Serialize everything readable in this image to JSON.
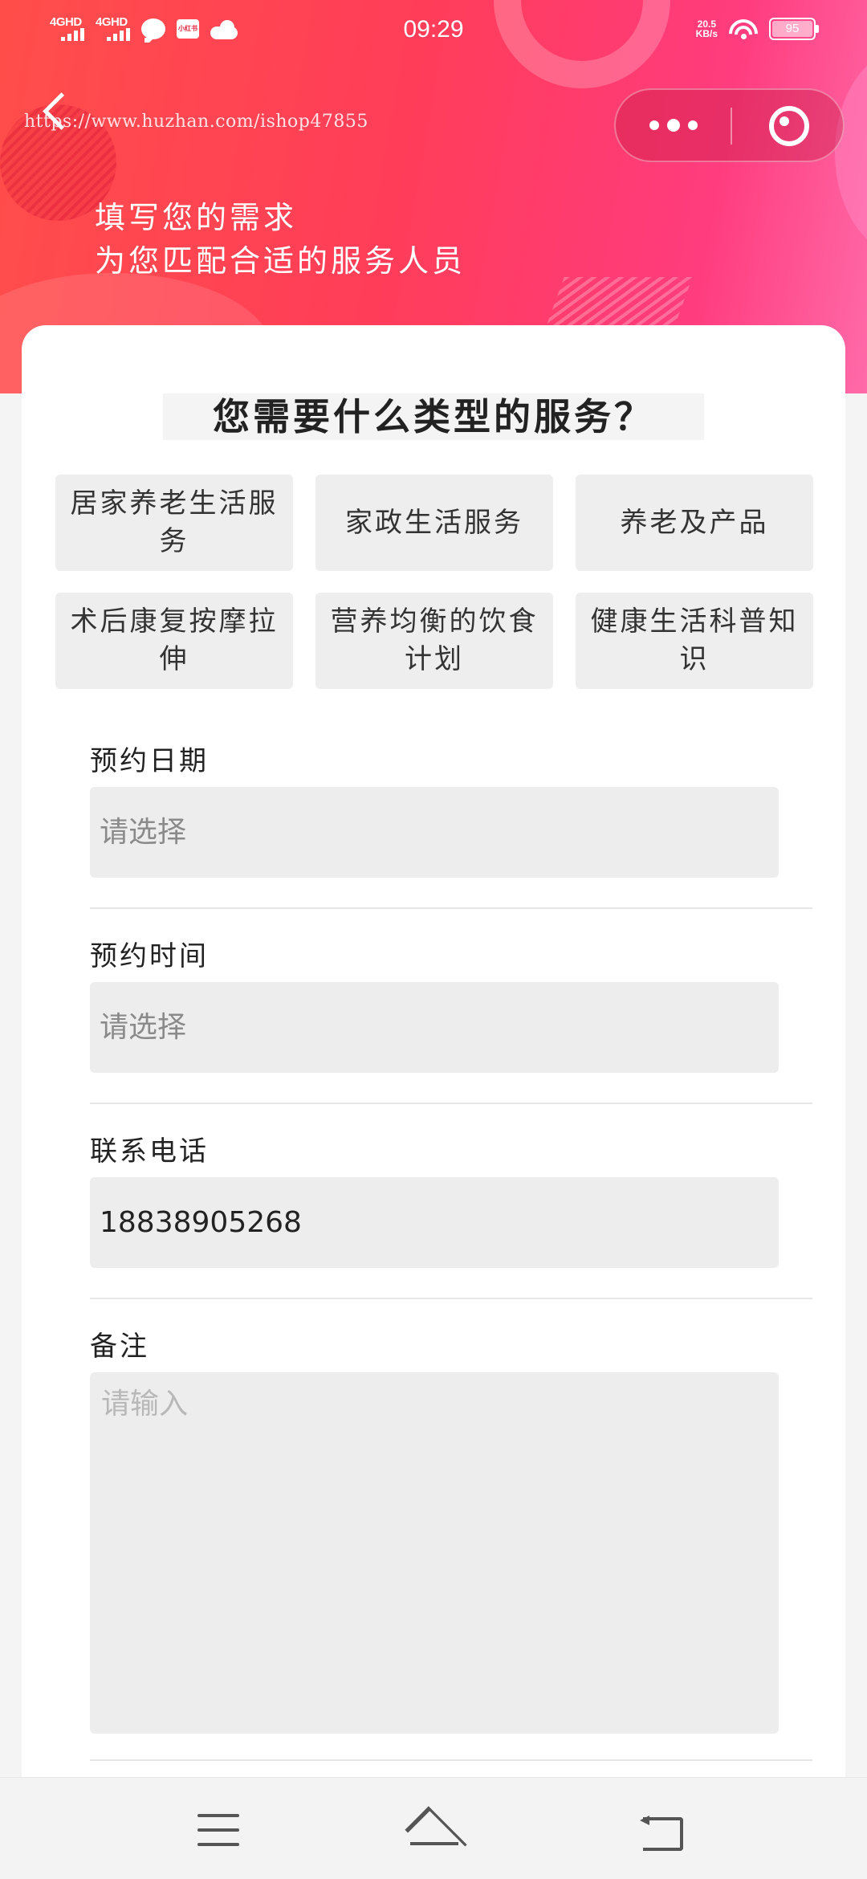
{
  "status_bar": {
    "signal_1": "4GHD",
    "signal_2": "4GHD",
    "app_badge": "小红书",
    "time": "09:29",
    "net_speed_value": "20.5",
    "net_speed_unit": "KB/s",
    "battery": "95"
  },
  "header": {
    "watermark": "https://www.huzhan.com/ishop47855",
    "banner_line1": "填写您的需求",
    "banner_line2": "为您匹配合适的服务人员"
  },
  "card": {
    "title": "您需要什么类型的服务？",
    "services": [
      {
        "label": "居家养老生活服务"
      },
      {
        "label": "家政生活服务"
      },
      {
        "label": "养老及产品"
      },
      {
        "label": "术后康复按摩拉伸"
      },
      {
        "label": "营养均衡的饮食计划"
      },
      {
        "label": "健康生活科普知识"
      }
    ]
  },
  "form": {
    "date": {
      "label": "预约日期",
      "placeholder": "请选择"
    },
    "time": {
      "label": "预约时间",
      "placeholder": "请选择"
    },
    "phone": {
      "label": "联系电话",
      "value": "18838905268"
    },
    "notes": {
      "label": "备注",
      "placeholder": "请输入"
    }
  },
  "colors": {
    "banner_start": "#ff4e4a",
    "banner_end": "#ff3c7e",
    "field_bg": "#ededed"
  }
}
